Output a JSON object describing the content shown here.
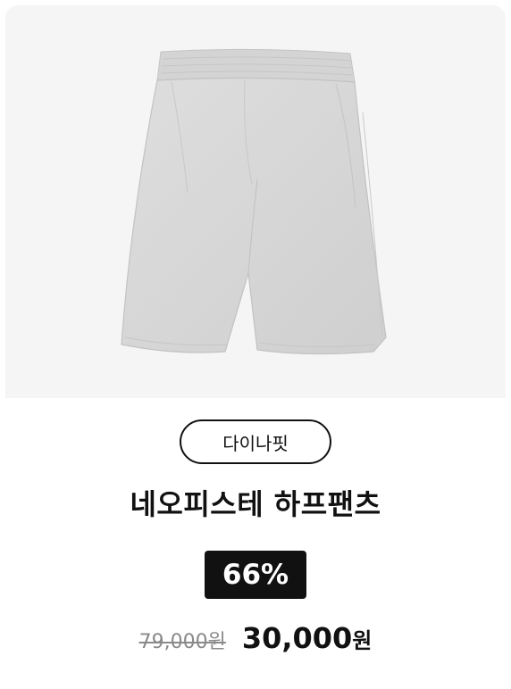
{
  "product": {
    "brand": "다이나핏",
    "name": "네오피스테 하프팬츠",
    "discount": "66%",
    "original_price": "79,000원",
    "sale_price_amount": "30,000",
    "sale_price_unit": "원",
    "image_icon": "shorts-product-image"
  },
  "colors": {
    "image_background": "#f5f5f5",
    "shorts_fill": "#d8d8d8",
    "badge_background": "#111111",
    "text_primary": "#111111",
    "text_muted": "#8a8a8a"
  }
}
